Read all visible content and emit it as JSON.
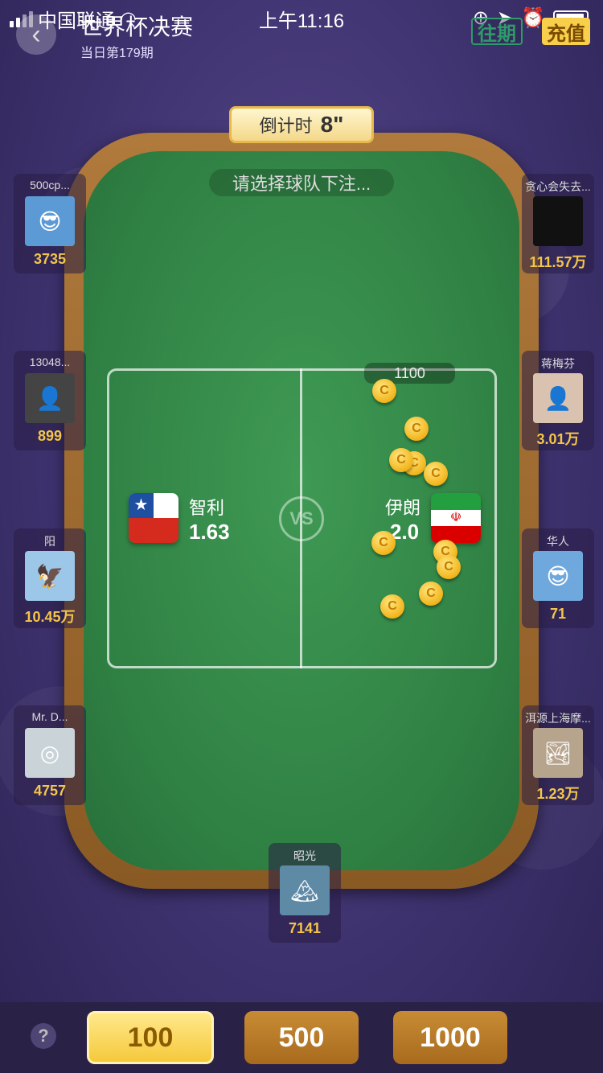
{
  "status_bar": {
    "carrier": "中国联通",
    "time": "上午11:16"
  },
  "header": {
    "title": "世界杯决赛",
    "subtitle": "当日第179期",
    "history_label": "往期",
    "recharge_label": "充值"
  },
  "table": {
    "countdown_label": "倒计时",
    "countdown_value": "8\"",
    "prompt": "请选择球队下注...",
    "pool_amount": "1100",
    "vs_label": "VS"
  },
  "teams": {
    "left": {
      "name": "智利",
      "odds": "1.63"
    },
    "right": {
      "name": "伊朗",
      "odds": "2.0"
    }
  },
  "players": {
    "left": [
      {
        "name": "500cp...",
        "coins": "3735"
      },
      {
        "name": "13048...",
        "coins": "899"
      },
      {
        "name": "阳",
        "coins": "10.45万"
      },
      {
        "name": "Mr. D...",
        "coins": "4757"
      }
    ],
    "right": [
      {
        "name": "贪心会失去...",
        "coins": "111.57万"
      },
      {
        "name": "蒋梅芬",
        "coins": "3.01万"
      },
      {
        "name": "华人",
        "coins": "71"
      },
      {
        "name": "洱源上海摩...",
        "coins": "1.23万"
      }
    ],
    "self": {
      "name": "昭光",
      "coins": "7141"
    }
  },
  "chips": {
    "c100": "100",
    "c500": "500",
    "c1000": "1000",
    "help": "?"
  },
  "coin_glyph": "C",
  "colors": {
    "felt": "#2f8043",
    "gold": "#f3c54a",
    "accent_green": "#2f9a6c"
  }
}
